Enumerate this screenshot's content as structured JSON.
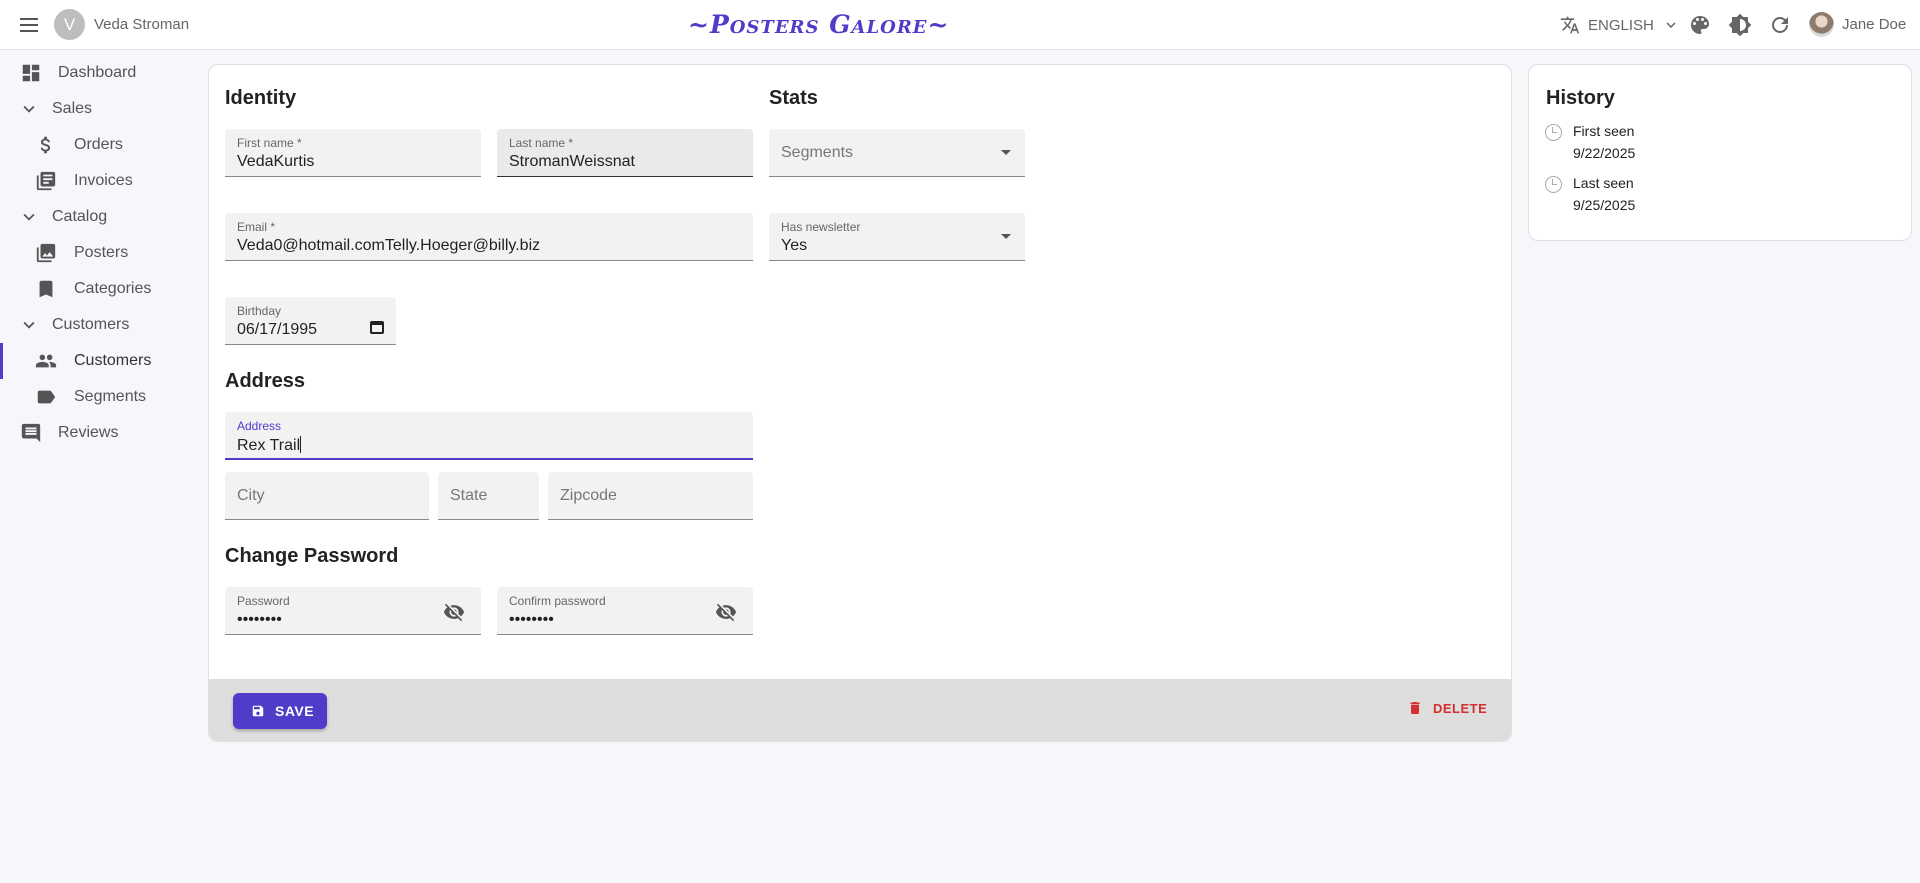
{
  "header": {
    "breadcrumb_initial": "V",
    "breadcrumb_name": "Veda Stroman",
    "brand": "~Posters Galore~",
    "language": "ENGLISH",
    "user_name": "Jane Doe"
  },
  "sidebar": {
    "items": [
      {
        "label": "Dashboard"
      },
      {
        "label": "Sales"
      },
      {
        "label": "Orders"
      },
      {
        "label": "Invoices"
      },
      {
        "label": "Catalog"
      },
      {
        "label": "Posters"
      },
      {
        "label": "Categories"
      },
      {
        "label": "Customers"
      },
      {
        "label": "Customers"
      },
      {
        "label": "Segments"
      },
      {
        "label": "Reviews"
      }
    ]
  },
  "form": {
    "identity_title": "Identity",
    "stats_title": "Stats",
    "address_title": "Address",
    "password_title": "Change Password",
    "first_name": {
      "label": "First name *",
      "value": "VedaKurtis"
    },
    "last_name": {
      "label": "Last name *",
      "value": "StromanWeissnat"
    },
    "email": {
      "label": "Email *",
      "value": "Veda0@hotmail.comTelly.Hoeger@billy.biz"
    },
    "birthday": {
      "label": "Birthday",
      "value": "06/17/1995"
    },
    "segments": {
      "placeholder": "Segments"
    },
    "newsletter": {
      "label": "Has newsletter",
      "value": "Yes"
    },
    "address": {
      "label": "Address",
      "value": "Rex Trail"
    },
    "city": {
      "placeholder": "City"
    },
    "state": {
      "placeholder": "State"
    },
    "zipcode": {
      "placeholder": "Zipcode"
    },
    "password": {
      "label": "Password",
      "value": "••••••••"
    },
    "confirm_password": {
      "label": "Confirm password",
      "value": "••••••••"
    }
  },
  "toolbar": {
    "save_label": "SAVE",
    "delete_label": "DELETE"
  },
  "history": {
    "title": "History",
    "first_seen_label": "First seen",
    "first_seen_value": "9/22/2025",
    "last_seen_label": "Last seen",
    "last_seen_value": "9/25/2025"
  },
  "colors": {
    "primary": "#4f3cc9",
    "danger": "#d32f2f"
  }
}
